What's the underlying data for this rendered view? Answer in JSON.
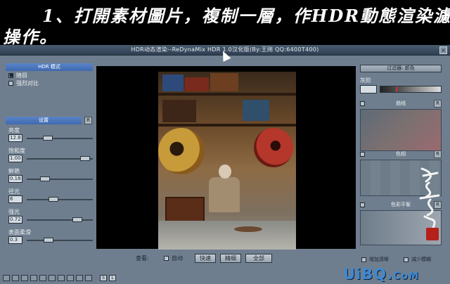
{
  "caption": {
    "line1": "1、打開素材圖片，複制一層，作HDR動態渲染濾鏡",
    "line2": "操作。"
  },
  "window": {
    "title": "HDR动态渲染--ReDynaMix HDR 1.0汉化版(By:王刚 QQ:6400T400)",
    "close_label": "×"
  },
  "left_panel": {
    "hdr_mode_header": "HDR 模式",
    "modes": [
      {
        "label": "随目",
        "checked": true
      },
      {
        "label": "强烈对比",
        "checked": false
      }
    ],
    "settings_header": "设置",
    "reset_label": "R",
    "params": [
      {
        "label": "亮度",
        "value": "12.8",
        "slider": 0.32
      },
      {
        "label": "饱和度",
        "value": "1.00",
        "slider": 0.88
      },
      {
        "label": "鲜艳",
        "value": "0.18",
        "slider": 0.28
      },
      {
        "label": "径光",
        "value": "6",
        "slider": 0.4
      },
      {
        "label": "强光",
        "value": "0.72",
        "slider": 0.77
      },
      {
        "label": "表面柔滑",
        "value": "0.3",
        "slider": 0.33
      }
    ]
  },
  "view_bar": {
    "label": "查看:",
    "auto_label": "自动",
    "auto_checked": true,
    "buttons": [
      "快速",
      "精细",
      "全部"
    ]
  },
  "right_panel": {
    "filter_title": "过滤器: 颜色",
    "gray_label": "灰阶",
    "reset_label": "R",
    "sections": [
      {
        "label": "曲线"
      },
      {
        "label": "色相"
      },
      {
        "label": "色彩平衡"
      }
    ],
    "bottom": [
      {
        "label": "增加清晰",
        "checked": false
      },
      {
        "label": "减少模糊",
        "checked": false
      }
    ]
  },
  "tabstrip": {
    "letters": [
      "S",
      "L"
    ]
  },
  "watermark": {
    "text": "UiBQ.",
    "suffix": "CoM"
  },
  "colors": {
    "window_bg": "#6f7e8e",
    "header_blue": "#4f77bd",
    "watermark_blue": "#3c8ad4",
    "seal_red": "#b52018"
  }
}
